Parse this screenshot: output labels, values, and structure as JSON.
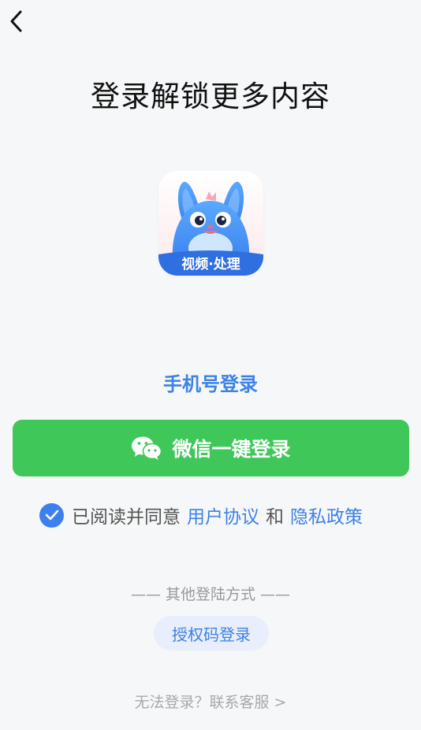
{
  "header": {
    "back_icon": "chevron-left-icon"
  },
  "title": "登录解锁更多内容",
  "logo": {
    "text": "视频·处理"
  },
  "phone_login_label": "手机号登录",
  "wechat_button": {
    "icon": "wechat-icon",
    "label": "微信一键登录"
  },
  "agreement": {
    "checked": true,
    "prefix": "已阅读并同意",
    "user_agreement": "用户协议",
    "conjunction": "和",
    "privacy_policy": "隐私政策"
  },
  "other_methods_label": "—— 其他登陆方式 ——",
  "auth_code_button": "授权码登录",
  "cant_login": "无法登录？联系客服 >",
  "colors": {
    "accent": "#3d82e6",
    "wechat": "#3fc75a",
    "check": "#3d7ff0"
  }
}
